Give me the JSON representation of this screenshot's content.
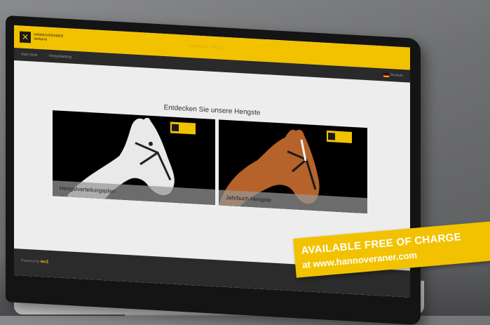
{
  "window": {
    "logo_icon": "hannoveraner-logo-icon",
    "logo_text_line1": "HANNOVERANER",
    "logo_text_line2": "Verband",
    "app_title": "Hengste 2023"
  },
  "nav": {
    "items": [
      {
        "label": "Start-Seite"
      },
      {
        "label": "Hengstkatalog"
      }
    ],
    "language": "Deutsch"
  },
  "main": {
    "heading": "Entdecken Sie unsere Hengste",
    "cards": [
      {
        "label": "Hengstverteilungsplan",
        "horse": "white-horse-image"
      },
      {
        "label": "Jahrbuch Hengste",
        "horse": "chestnut-horse-image"
      }
    ]
  },
  "footer": {
    "powered_prefix": "Powered by",
    "powered_brand": "wc2"
  },
  "promo": {
    "line1": "AVAILABLE FREE OF CHARGE",
    "line2": "at www.hannoveraner.com"
  },
  "colors": {
    "brand_yellow": "#f2c200",
    "nav_dark": "#2a2a2a",
    "screen_bg": "#ededed"
  }
}
